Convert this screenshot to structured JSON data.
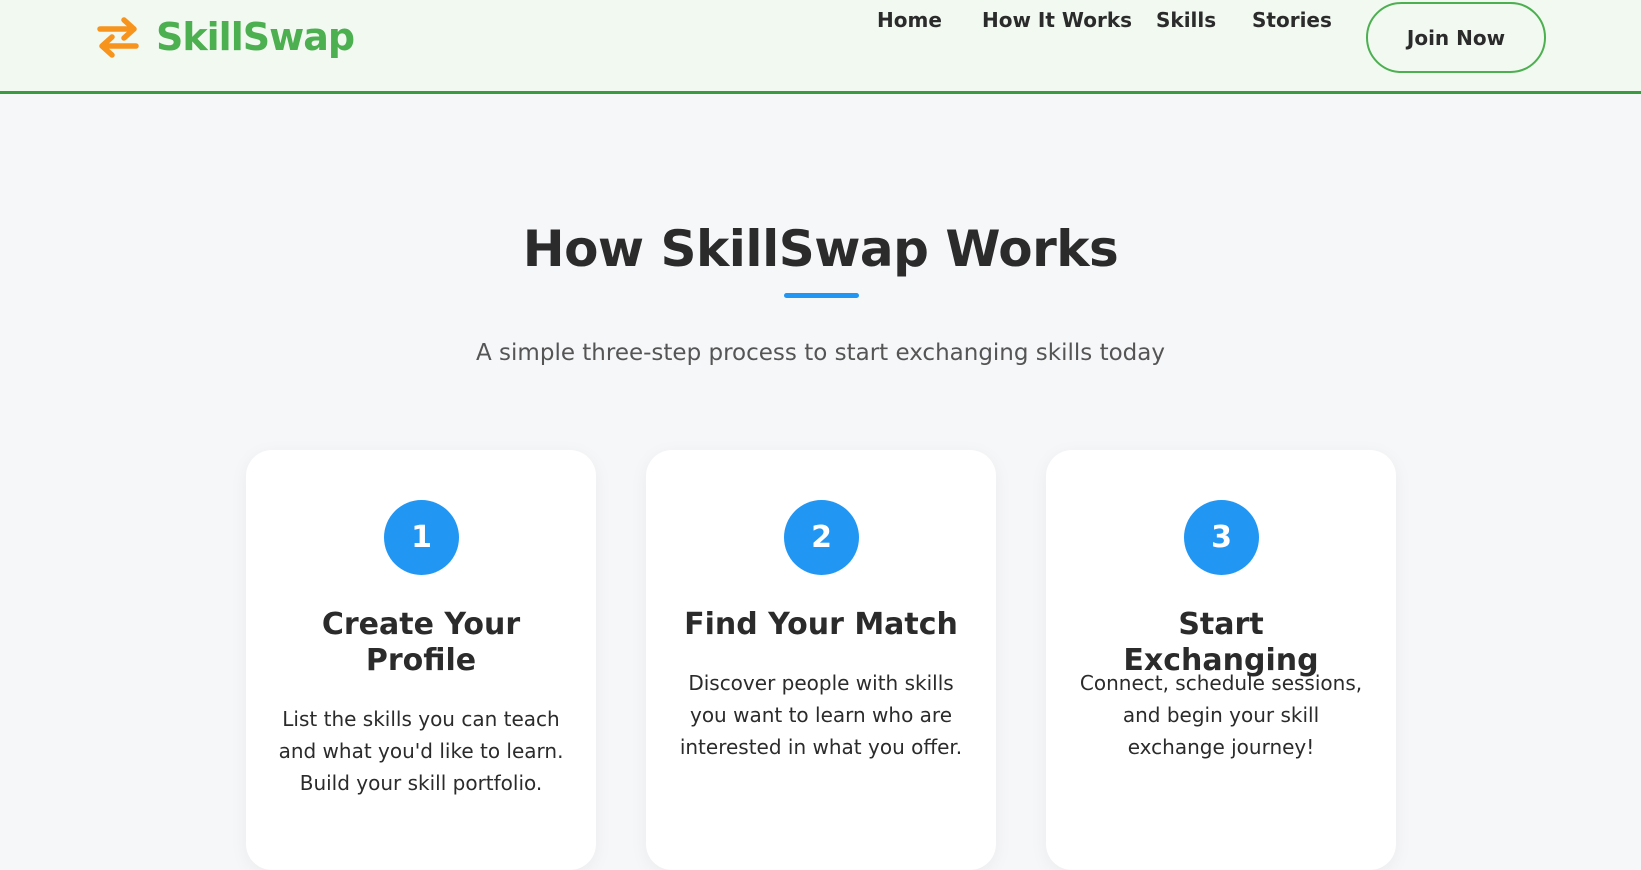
{
  "header": {
    "logo_text": "SkillSwap",
    "nav": [
      {
        "label": "Home"
      },
      {
        "label": "How It Works"
      },
      {
        "label": "Skills"
      },
      {
        "label": "Stories"
      }
    ],
    "cta_label": "Join Now"
  },
  "section": {
    "title": "How SkillSwap Works",
    "subtitle": "A simple three-step process to start exchanging skills today",
    "steps": [
      {
        "number": "1",
        "title": "Create Your Profile",
        "description": "List the skills you can teach and what you'd like to learn. Build your skill portfolio."
      },
      {
        "number": "2",
        "title": "Find Your Match",
        "description": "Discover people with skills you want to learn who are interested in what you offer."
      },
      {
        "number": "3",
        "title": "Start Exchanging",
        "description": "Connect, schedule sessions, and begin your skill exchange journey!"
      }
    ]
  },
  "colors": {
    "brand_green": "#4caf50",
    "accent_orange": "#f7941d",
    "accent_blue": "#2196f3",
    "header_border": "#3a9a3f"
  },
  "icons": {
    "logo": "swap-arrows-icon"
  }
}
